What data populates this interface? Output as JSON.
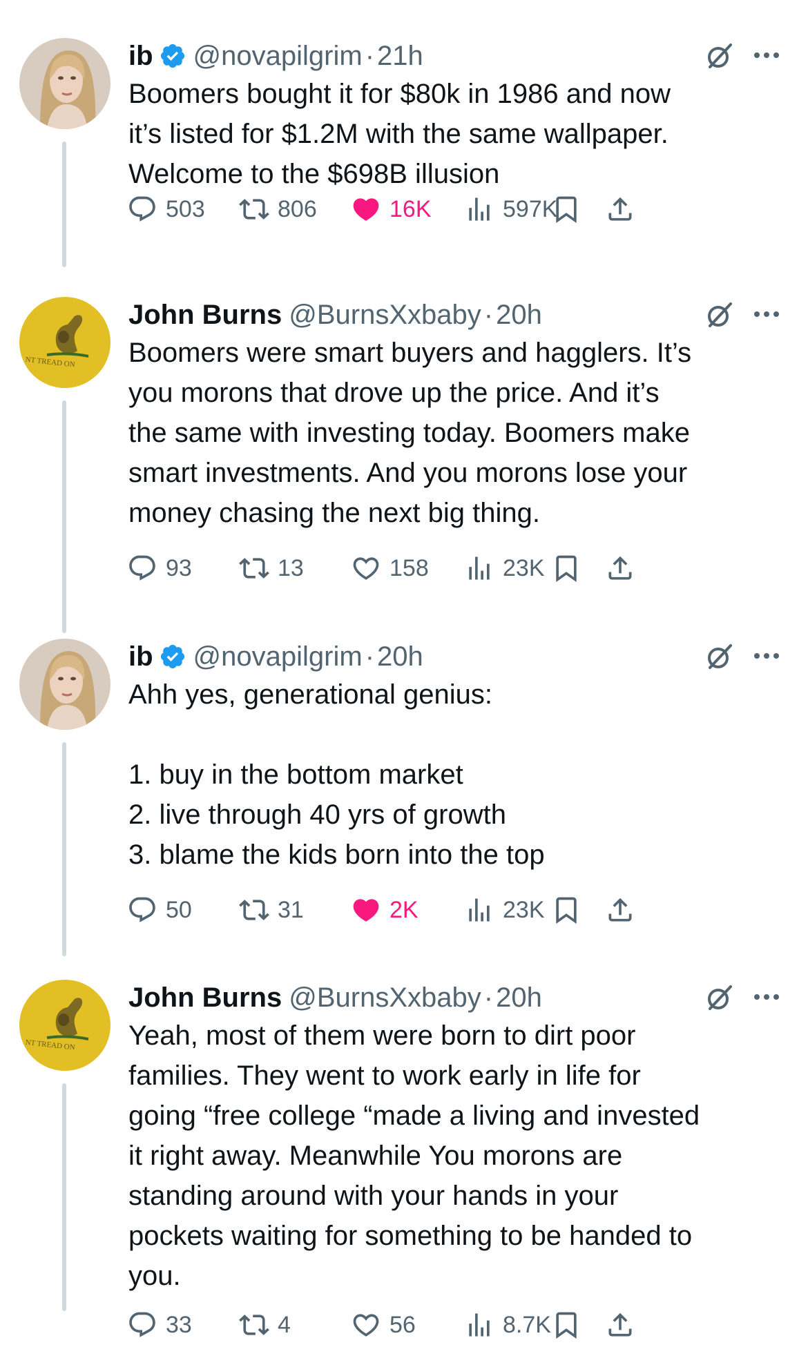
{
  "thread": [
    {
      "name": "ib",
      "verified": true,
      "handle": "@novapilgrim",
      "separator": "·",
      "time": "21h",
      "avatar": "woman-portrait",
      "text": "Boomers bought it for $80k in 1986 and now\nit’s listed for $1.2M with the same wallpaper.\nWelcome to the $698B illusion",
      "replies": "503",
      "reposts": "806",
      "likes": "16K",
      "liked": true,
      "views": "597K"
    },
    {
      "name": "John Burns",
      "verified": false,
      "handle": "@BurnsXxbaby",
      "separator": "·",
      "time": "20h",
      "avatar": "gadsden-flag",
      "avatar_text": "NT TREAD ON",
      "text": "Boomers were smart buyers and hagglers. It’s\nyou morons that drove up the price. And it’s\nthe same with investing today. Boomers make\nsmart investments. And you morons lose your\nmoney chasing the next big thing.",
      "replies": "93",
      "reposts": "13",
      "likes": "158",
      "liked": false,
      "views": "23K"
    },
    {
      "name": "ib",
      "verified": true,
      "handle": "@novapilgrim",
      "separator": "·",
      "time": "20h",
      "avatar": "woman-portrait",
      "text": "Ahh yes, generational genius:\n\n1. buy in the bottom market\n2. live through 40 yrs of growth\n3. blame the kids born into the top",
      "replies": "50",
      "reposts": "31",
      "likes": "2K",
      "liked": true,
      "views": "23K"
    },
    {
      "name": "John Burns",
      "verified": false,
      "handle": "@BurnsXxbaby",
      "separator": "·",
      "time": "20h",
      "avatar": "gadsden-flag",
      "avatar_text": "NT TREAD ON",
      "text": "Yeah, most of them were born to dirt poor\nfamilies. They went to work early in life for\ngoing “free college “made a living and invested\nit right away. Meanwhile You morons are\nstanding around with your hands in your\npockets waiting for something to be handed to\nyou.",
      "replies": "33",
      "reposts": "4",
      "likes": "56",
      "liked": false,
      "views": "8.7K"
    }
  ],
  "colors": {
    "like_active": "#f91880",
    "verified_blue": "#1d9bf0",
    "muted_text": "#536471",
    "thread_line": "#cfd9de"
  }
}
